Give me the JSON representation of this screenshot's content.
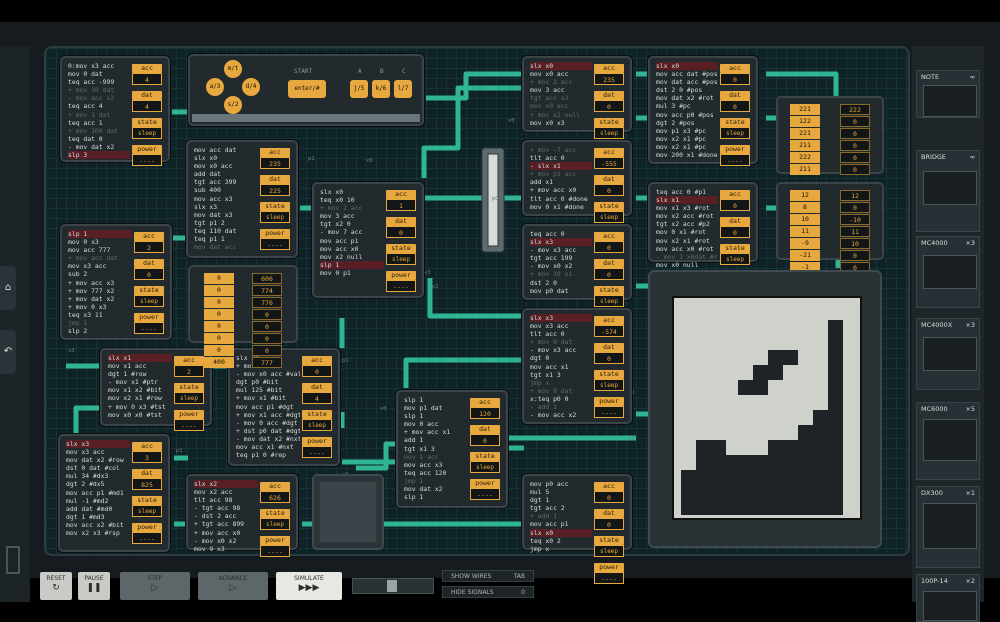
{
  "chips": [
    {
      "id": "c1",
      "lines": [
        [
          "0:mov x3 acc",
          ""
        ],
        [
          "mov 0 dat",
          ""
        ],
        [
          "teq acc -999",
          ""
        ],
        [
          "+ mov 10 dat",
          "cm"
        ],
        [
          "- mov acc x2",
          "cm"
        ],
        [
          "teq acc 4",
          ""
        ],
        [
          "+ mov 1 dat",
          "cm"
        ],
        [
          "teq acc 1",
          ""
        ],
        [
          "+ mov 100 dat",
          "cm"
        ],
        [
          "teq dat 0",
          ""
        ],
        [
          "- mov dat x2",
          ""
        ],
        [
          "slp 3",
          "hl"
        ]
      ],
      "regs": [
        [
          "acc",
          "4"
        ],
        [
          "dat",
          "4"
        ],
        [
          "state",
          "sleep"
        ],
        [
          "power",
          "----"
        ]
      ]
    },
    {
      "id": "c2",
      "lines": [
        [
          "mov acc dat",
          ""
        ],
        [
          "slx x0",
          ""
        ],
        [
          "mov x0 acc",
          ""
        ],
        [
          "add dat",
          ""
        ],
        [
          "tgt acc 399",
          ""
        ],
        [
          "sub 400",
          ""
        ],
        [
          "mov acc x3",
          ""
        ],
        [
          "slx x3",
          ""
        ],
        [
          "mov dat x3",
          ""
        ],
        [
          "tgt p1 2",
          ""
        ],
        [
          "teq 110 dat",
          ""
        ],
        [
          "teq p1 1",
          ""
        ],
        [
          "mov dat acc",
          "cm"
        ]
      ],
      "regs": [
        [
          "acc",
          "235"
        ],
        [
          "dat",
          "225"
        ],
        [
          "state",
          "sleep"
        ],
        [
          "power",
          "----"
        ]
      ]
    },
    {
      "id": "c3",
      "lines": [
        [
          "slp 1",
          "hl"
        ],
        [
          "mov 0 x3",
          ""
        ],
        [
          "mov acc 777",
          ""
        ],
        [
          "+ mov acc dat",
          "cm"
        ],
        [
          "mov x3 acc",
          ""
        ],
        [
          "sub 2",
          ""
        ],
        [
          "+ mov acc x3",
          ""
        ],
        [
          "+ mov 777 x2",
          ""
        ],
        [
          "+ mov dat x2",
          ""
        ],
        [
          "+ mov 0 x3",
          ""
        ],
        [
          "teq x3 11",
          ""
        ],
        [
          "jmp 1",
          "cm"
        ],
        [
          "slp 2",
          ""
        ]
      ],
      "regs": [
        [
          "acc",
          "2"
        ],
        [
          "dat",
          "0"
        ],
        [
          "state",
          "sleep"
        ],
        [
          "power",
          "----"
        ]
      ]
    },
    {
      "id": "c4",
      "lines": [
        [
          "slx x0",
          ""
        ],
        [
          "teq x0 10",
          ""
        ],
        [
          "+ mov 2 acc",
          "cm"
        ],
        [
          "mov 3 acc",
          ""
        ],
        [
          "tgt x2 0",
          ""
        ],
        [
          "- mov 7 acc",
          ""
        ],
        [
          "mov acc p1",
          ""
        ],
        [
          "mov acc x0",
          ""
        ],
        [
          "mov x2 null",
          ""
        ],
        [
          "slp 1",
          "hl"
        ],
        [
          "mov 0 p1",
          ""
        ]
      ],
      "regs": [
        [
          "acc",
          "1"
        ],
        [
          "dat",
          "0"
        ],
        [
          "state",
          "sleep"
        ],
        [
          "power",
          "----"
        ]
      ]
    },
    {
      "id": "c5",
      "lines": [
        [
          "slx x0",
          "hl"
        ],
        [
          "mov x0 acc",
          ""
        ],
        [
          "+ mov 2 acc",
          "cm"
        ],
        [
          "mov 3 acc",
          ""
        ],
        [
          "tgt acc x2",
          "cm"
        ],
        [
          "mov x0 acc",
          "cm"
        ],
        [
          "+ mov x2 null",
          "cm"
        ],
        [
          "mov x0 x3",
          ""
        ]
      ],
      "regs": [
        [
          "acc",
          "235"
        ],
        [
          "dat",
          "0"
        ],
        [
          "state",
          "sleep"
        ],
        [
          "power",
          "----"
        ]
      ]
    },
    {
      "id": "c6",
      "lines": [
        [
          "slx x0",
          "hl"
        ],
        [
          "mov acc dat #pos",
          ""
        ],
        [
          "mov dat acc #pos",
          ""
        ],
        [
          "dst 2 0 #pos",
          ""
        ],
        [
          "mov dat x2 #rot",
          ""
        ],
        [
          "mul 3 #pc",
          ""
        ],
        [
          "mov acc p0 #pos",
          ""
        ],
        [
          "dgt 2 #pos",
          ""
        ],
        [
          "mov p1 x3 #pc",
          ""
        ],
        [
          "mov x2 x1 #pc",
          ""
        ],
        [
          "mov x2 x1 #pc",
          ""
        ],
        [
          "mov 200 x1 #done",
          ""
        ]
      ],
      "regs": [
        [
          "acc",
          "0"
        ],
        [
          "dat",
          "0"
        ],
        [
          "state",
          "sleep"
        ],
        [
          "power",
          "----"
        ]
      ]
    },
    {
      "id": "c7",
      "lines": [
        [
          "+ mov -7 acc",
          "cm"
        ],
        [
          "tlt acc 0",
          ""
        ],
        [
          "- slx x1",
          "hl"
        ],
        [
          "+ mov p1 acc",
          "cm"
        ],
        [
          "add x1",
          ""
        ],
        [
          "+ mov acc x0",
          ""
        ],
        [
          "tlt acc 0 #done",
          ""
        ],
        [
          "mov 0 x1 #done",
          ""
        ]
      ],
      "regs": [
        [
          "acc",
          "-555"
        ],
        [
          "dat",
          "0"
        ],
        [
          "state",
          "sleep"
        ],
        [
          "power",
          "----"
        ]
      ]
    },
    {
      "id": "c8",
      "lines": [
        [
          "teq acc 0 #p1",
          ""
        ],
        [
          "slx x1",
          "hl"
        ],
        [
          "mov x1 x3 #rot",
          ""
        ],
        [
          "mov x2 acc #rot",
          ""
        ],
        [
          "tgt x2 acc #p2",
          ""
        ],
        [
          "mov 0 x1 #rot",
          ""
        ],
        [
          "mov x2 x1 #rot",
          ""
        ],
        [
          "mov acc x0 #rot",
          ""
        ],
        [
          "- mov 1 x0dat #rot",
          "cm"
        ],
        [
          "mov x0 null",
          ""
        ]
      ],
      "regs": [
        [
          "acc",
          "0"
        ],
        [
          "dat",
          "0"
        ],
        [
          "state",
          "sleep"
        ],
        [
          "power",
          "----"
        ]
      ]
    },
    {
      "id": "c9",
      "lines": [
        [
          "teq acc 0",
          ""
        ],
        [
          "slx x3",
          "hl"
        ],
        [
          "- mov x3 acc",
          ""
        ],
        [
          "tgt acc 199",
          ""
        ],
        [
          "- mov x0 x2",
          ""
        ],
        [
          "+ mov 10 x1",
          "cm"
        ],
        [
          "dst 2 0",
          ""
        ],
        [
          "mov p0 dat",
          ""
        ]
      ],
      "regs": [
        [
          "acc",
          "0"
        ],
        [
          "dat",
          "0"
        ],
        [
          "state",
          "sleep"
        ],
        [
          "power",
          "----"
        ]
      ]
    },
    {
      "id": "c10",
      "lines": [
        [
          "slx x1",
          "hl"
        ],
        [
          "mov x1 acc",
          ""
        ],
        [
          "dgt 1 #row",
          ""
        ],
        [
          "- mov x1 #ptr",
          ""
        ],
        [
          "mov x1 x2 #bit",
          ""
        ],
        [
          "mov x2 x1 #row",
          ""
        ],
        [
          "+ mov 0 x3 #tst",
          ""
        ],
        [
          "mov x0 x0 #tst",
          ""
        ]
      ],
      "regs": [
        [
          "acc",
          "2"
        ],
        [
          "state",
          "sleep"
        ],
        [
          "power",
          "----"
        ]
      ]
    },
    {
      "id": "c11",
      "lines": [
        [
          "slx x1",
          ""
        ],
        [
          "+ mov x1 acc",
          ""
        ],
        [
          "- mov x0 acc #val",
          ""
        ],
        [
          "dgt p0 #bit",
          ""
        ],
        [
          "mul 125 #bit",
          ""
        ],
        [
          "+ mov x1 #bit",
          ""
        ],
        [
          "mov acc p1 #dgt",
          ""
        ],
        [
          "+ mov x1 acc #dgt",
          ""
        ],
        [
          "- mov 0 acc #dgt",
          ""
        ],
        [
          "+ dst p0 dat #dgt",
          ""
        ],
        [
          "- mov dat x2 #nxt",
          ""
        ],
        [
          "mov acc x1 #nxt",
          ""
        ],
        [
          "teq p1 0 #rep",
          ""
        ]
      ],
      "regs": [
        [
          "acc",
          "0"
        ],
        [
          "dat",
          "4"
        ],
        [
          "state",
          "sleep"
        ],
        [
          "power",
          "----"
        ]
      ]
    },
    {
      "id": "c12",
      "lines": [
        [
          "slx x3",
          "hl"
        ],
        [
          "mov x3 acc",
          ""
        ],
        [
          "mov dat x2 #row",
          ""
        ],
        [
          "dst 0 dat #col",
          ""
        ],
        [
          "mul 34 #dx3",
          ""
        ],
        [
          "dgt 2 #dx5",
          ""
        ],
        [
          "mov acc p1 #md1",
          ""
        ],
        [
          "mul -1 #md2",
          ""
        ],
        [
          "add dat #md0",
          ""
        ],
        [
          "dgt 1 #md3",
          ""
        ],
        [
          "mov acc x2 #bit",
          ""
        ],
        [
          "mov x2 x3 #rsp",
          ""
        ]
      ],
      "regs": [
        [
          "acc",
          "3"
        ],
        [
          "dat",
          "825"
        ],
        [
          "state",
          "sleep"
        ],
        [
          "power",
          "----"
        ]
      ]
    },
    {
      "id": "c13",
      "lines": [
        [
          "slx x2",
          "hl"
        ],
        [
          "mov x2 acc",
          ""
        ],
        [
          "tlt acc 98",
          ""
        ],
        [
          "- tgt acc 98",
          ""
        ],
        [
          "- dst 2 acc",
          ""
        ],
        [
          "+ tgt acc 899",
          ""
        ],
        [
          "+ mov acc x0",
          ""
        ],
        [
          "- mov x0 x2",
          ""
        ],
        [
          "mov 9 x3",
          ""
        ]
      ],
      "regs": [
        [
          "acc",
          "626"
        ],
        [
          "state",
          "sleep"
        ],
        [
          "power",
          "----"
        ]
      ]
    },
    {
      "id": "c14",
      "lines": [
        [
          "slp 1",
          ""
        ],
        [
          "mov p1 dat",
          ""
        ],
        [
          "slp 1",
          ""
        ],
        [
          "mov 0 acc",
          ""
        ],
        [
          "+ mov acc x1",
          ""
        ],
        [
          "add 1",
          ""
        ],
        [
          "tgt x1 3",
          ""
        ],
        [
          "mov 1 acc",
          "cm"
        ],
        [
          "mov acc x3",
          ""
        ],
        [
          "teq acc 120",
          ""
        ],
        [
          "jmp 1",
          "cm"
        ],
        [
          "mov dat x2",
          ""
        ],
        [
          "slp 1",
          ""
        ]
      ],
      "regs": [
        [
          "acc",
          "120"
        ],
        [
          "dat",
          "0"
        ],
        [
          "state",
          "sleep"
        ],
        [
          "power",
          "----"
        ]
      ]
    },
    {
      "id": "c15",
      "lines": [
        [
          "slx x3",
          "hl"
        ],
        [
          "mov x3 acc",
          ""
        ],
        [
          "tlt acc 0",
          ""
        ],
        [
          "+ mov 0 dat",
          "cm"
        ],
        [
          "- mov x3 acc",
          ""
        ],
        [
          "dgt 0",
          ""
        ],
        [
          "mov acc x1",
          ""
        ],
        [
          "tgt x1 3",
          ""
        ],
        [
          "jmp x",
          "cm"
        ],
        [
          "+ mov 0 dat",
          "cm"
        ],
        [
          "x:teq p0 0",
          ""
        ],
        [
          "- add 1",
          "cm"
        ],
        [
          "- mov acc x2",
          ""
        ]
      ],
      "regs": [
        [
          "acc",
          "-574"
        ],
        [
          "dat",
          "0"
        ],
        [
          "state",
          "sleep"
        ],
        [
          "power",
          "----"
        ]
      ]
    },
    {
      "id": "c16",
      "lines": [
        [
          "mov p0 acc",
          ""
        ],
        [
          "mul 5",
          ""
        ],
        [
          "dgt 1",
          ""
        ],
        [
          "tgt acc 2",
          ""
        ],
        [
          "+ add 1",
          "cm"
        ],
        [
          "mov acc p1",
          ""
        ],
        [
          "slx x0",
          "hl"
        ],
        [
          "teq x0 2",
          ""
        ],
        [
          "jmp x",
          ""
        ]
      ],
      "regs": [
        [
          "acc",
          "0"
        ],
        [
          "dat",
          "0"
        ],
        [
          "state",
          "sleep"
        ],
        [
          "power",
          "----"
        ]
      ]
    }
  ],
  "ram1": {
    "left": [
      "0",
      "0",
      "0",
      "0",
      "0",
      "0",
      "0",
      "400"
    ],
    "right": [
      "606",
      "774",
      "776",
      "0",
      "0",
      "0",
      "0",
      "777"
    ]
  },
  "ram2": {
    "left": [
      "221",
      "122",
      "221",
      "211",
      "222",
      "211"
    ],
    "right": [
      "222",
      "0",
      "0",
      "0",
      "0",
      "0"
    ]
  },
  "ram3": {
    "left": [
      "12",
      "8",
      "10",
      "11",
      "-9",
      "-21",
      "-1"
    ],
    "right": [
      "12",
      "0",
      "-10",
      "11",
      "10",
      "0",
      "0"
    ]
  },
  "controller": {
    "dpad": {
      "up": "m/t",
      "left": "a/3",
      "right": "d/4",
      "down": "s/2"
    },
    "start_label": "START",
    "start_key": "enter/#",
    "abc_labels": [
      "A",
      "B",
      "C"
    ],
    "abc_keys": [
      "j/5",
      "k/6",
      "l/7"
    ]
  },
  "toolbox": [
    {
      "name": "NOTE",
      "count": "∞"
    },
    {
      "name": "BRIDGE",
      "count": "∞"
    },
    {
      "name": "MC4000",
      "count": "×3"
    },
    {
      "name": "MC4000X",
      "count": "×3"
    },
    {
      "name": "MC6000",
      "count": "×5"
    },
    {
      "name": "DX300",
      "count": "×1"
    },
    {
      "name": "100P-14",
      "count": "×2"
    }
  ],
  "bottom": {
    "reset": "RESET",
    "pause": "PAUSE",
    "step": "STEP",
    "advance": "ADVANCE",
    "simulate": "SIMULATE",
    "show_wires": "SHOW WIRES",
    "show_wires_key": "TAB",
    "hide_signals": "HIDE SIGNALS",
    "hide_signals_key": "0"
  },
  "pins": [
    "x1",
    "x3",
    "x0",
    "p1",
    "x2",
    "p0",
    "x3",
    "x1",
    "x0",
    "p1",
    "x2",
    "x1",
    "x3",
    "x2",
    "p1",
    "x0",
    "x1"
  ],
  "colors": {
    "accent": "#e7a93f",
    "wire": "#2fb494",
    "board": "#0f2226",
    "chip": "#232a2d",
    "highlight": "#5a1f24"
  }
}
